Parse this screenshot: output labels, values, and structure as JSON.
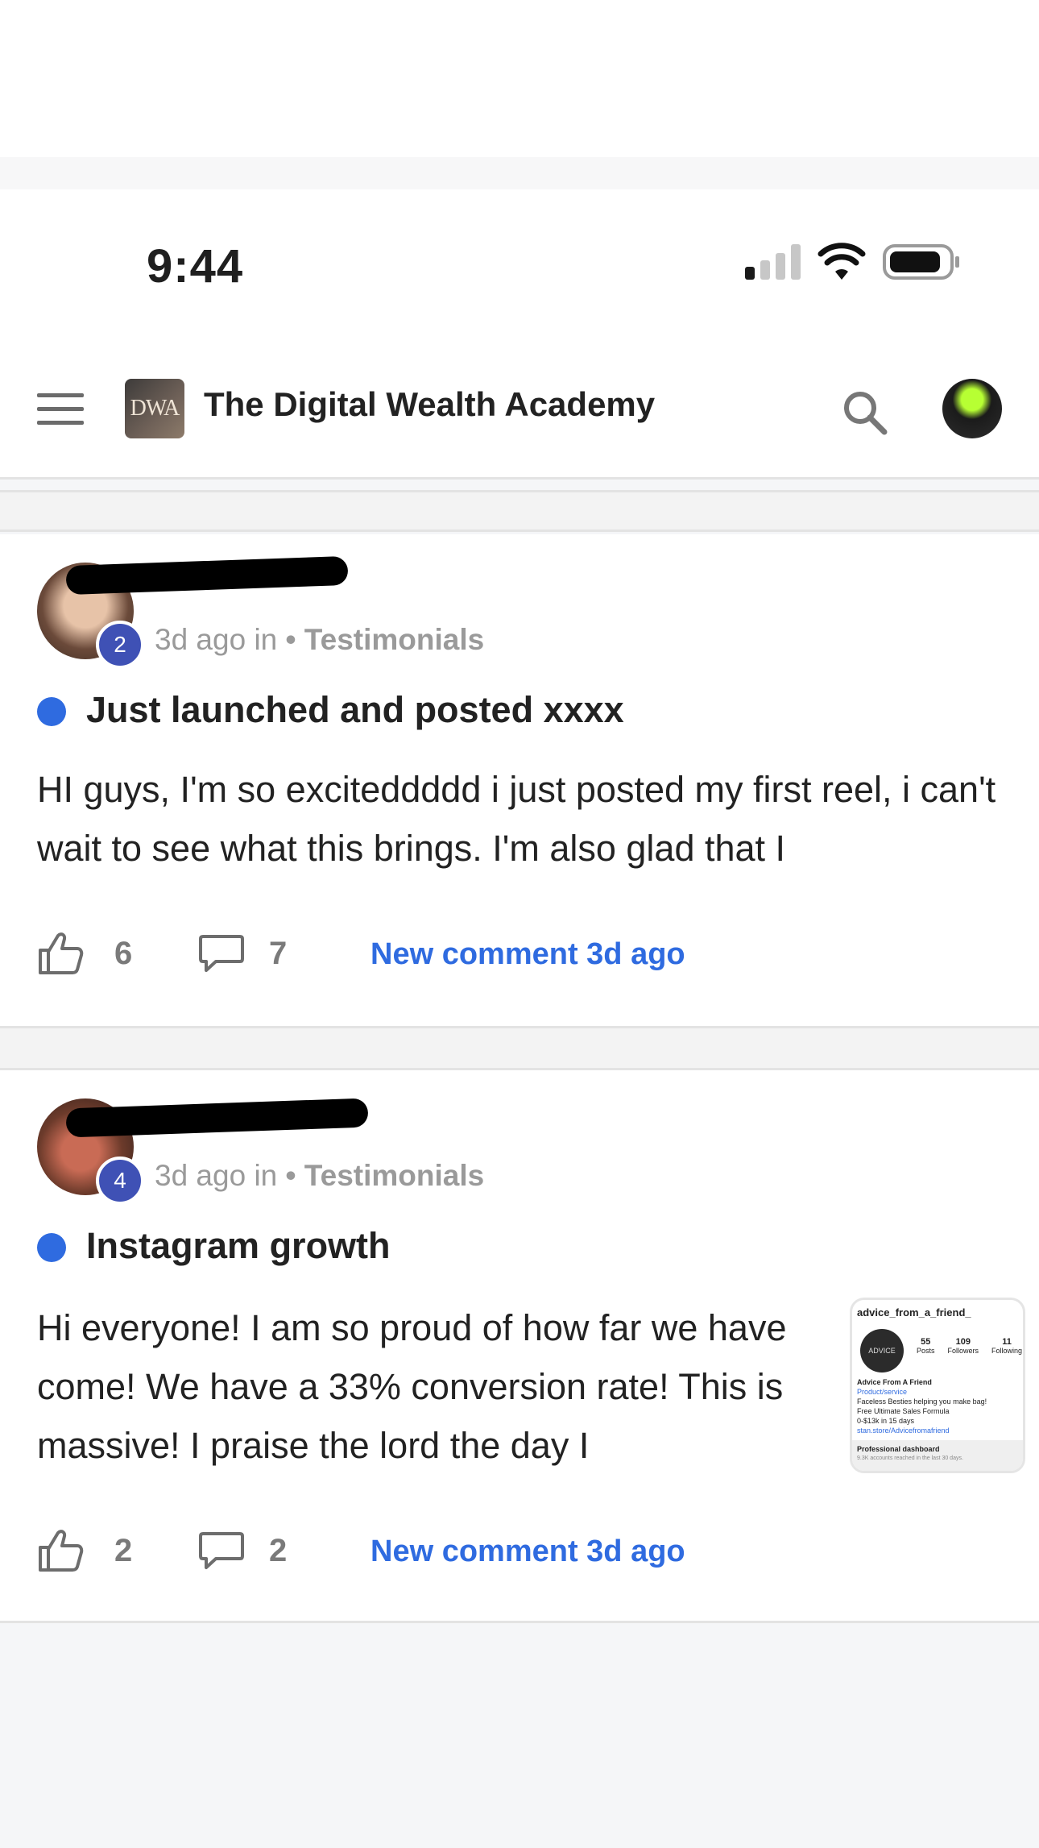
{
  "status": {
    "time": "9:44"
  },
  "header": {
    "logo_text": "DWA",
    "title": "The Digital Wealth Academy"
  },
  "posts": [
    {
      "level": "2",
      "meta_time": "3d ago in",
      "category": "• Testimonials",
      "title": "Just launched and posted xxxx",
      "body": "HI guys, I'm so exciteddddd i just posted my first reel, i can't wait to see what this brings. I'm also glad that I",
      "likes": "6",
      "comments": "7",
      "new_comment": "New comment 3d ago"
    },
    {
      "level": "4",
      "meta_time": "3d ago in",
      "category": "• Testimonials",
      "title": "Instagram growth",
      "body": "Hi everyone! I am so proud of how far we have come! We have a 33% conversion rate! This is massive! I praise the lord the day I",
      "likes": "2",
      "comments": "2",
      "new_comment": "New comment 3d ago",
      "thumbnail": {
        "handle": "advice_from_a_friend_",
        "pic_text": "ADVICE",
        "posts": "55",
        "posts_label": "Posts",
        "followers": "109",
        "followers_label": "Followers",
        "following": "11",
        "following_label": "Following",
        "bio_name": "Advice From A Friend",
        "bio_line1": "Product/service",
        "bio_line2": "Faceless Besties helping you make bag!",
        "bio_line3": "Free Ultimate Sales Formula",
        "bio_line4": "0-$13k in 15 days",
        "bio_link": "stan.store/Advicefromafriend",
        "dash_title": "Professional dashboard",
        "dash_sub": "9.3K accounts reached in the last 30 days."
      }
    }
  ]
}
